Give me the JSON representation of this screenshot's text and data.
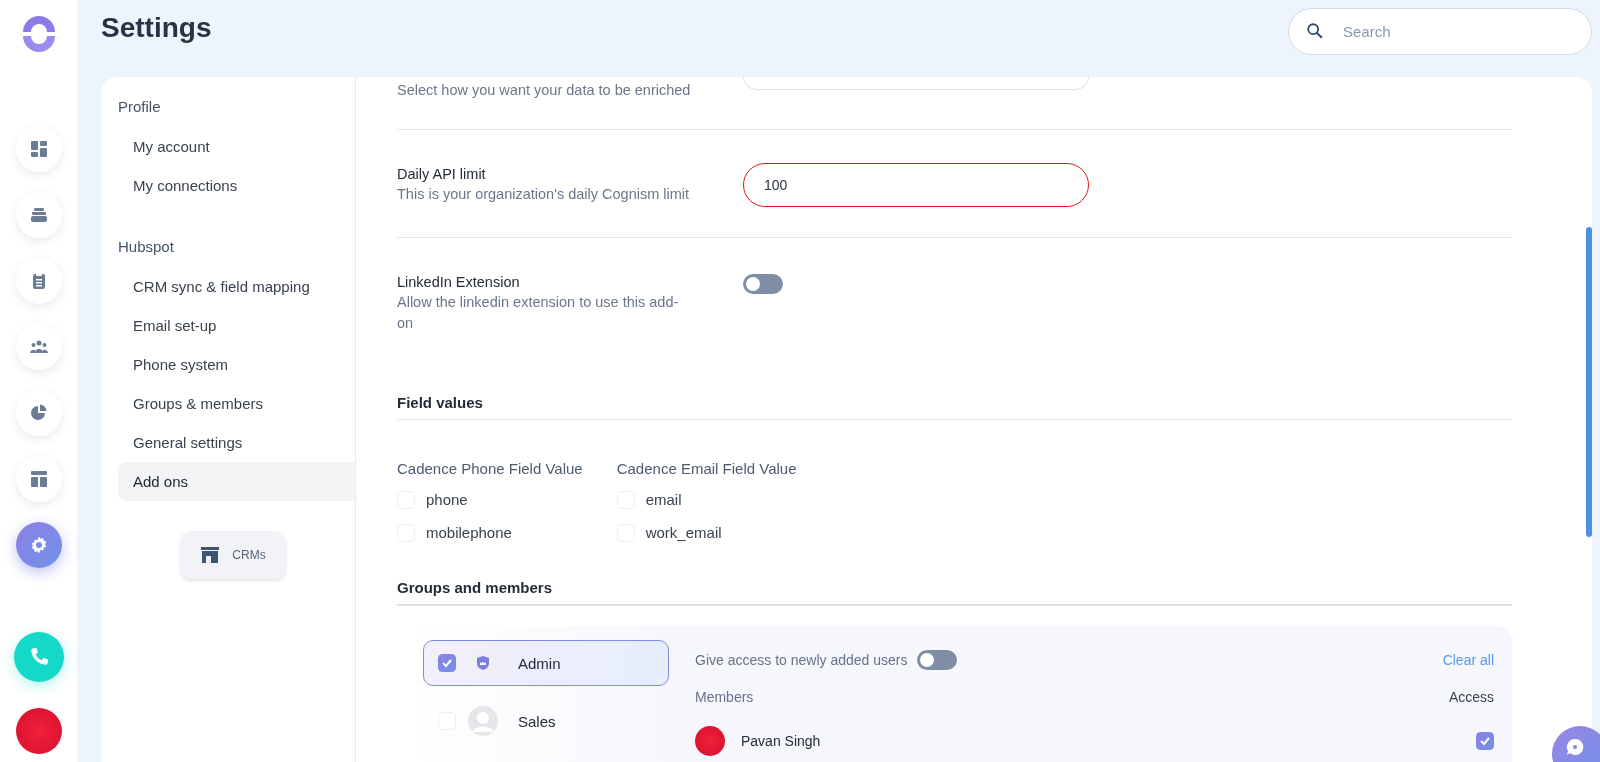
{
  "app": {
    "title": "Settings"
  },
  "search": {
    "placeholder": "Search"
  },
  "rail": [
    {
      "kind": "dashboard",
      "selected": false
    },
    {
      "kind": "inbox",
      "selected": false
    },
    {
      "kind": "clipboard",
      "selected": false
    },
    {
      "kind": "people",
      "selected": false
    },
    {
      "kind": "pie",
      "selected": false
    },
    {
      "kind": "layout",
      "selected": false
    },
    {
      "kind": "settings",
      "selected": true
    }
  ],
  "nav": {
    "sections": [
      {
        "title": "Profile",
        "items": [
          {
            "label": "My account",
            "selected": false
          },
          {
            "label": "My connections",
            "selected": false
          }
        ]
      },
      {
        "title": "Hubspot",
        "items": [
          {
            "label": "CRM sync & field mapping",
            "selected": false
          },
          {
            "label": "Email set-up",
            "selected": false
          },
          {
            "label": "Phone system",
            "selected": false
          },
          {
            "label": "Groups & members",
            "selected": false
          },
          {
            "label": "General settings",
            "selected": false
          },
          {
            "label": "Add ons",
            "selected": true
          }
        ]
      }
    ],
    "crm_button": "CRMs"
  },
  "settings": [
    {
      "kind": "select",
      "description": "Select how you want your data to be enriched"
    },
    {
      "kind": "input",
      "label": "Daily API limit",
      "description": "This is your organization's daily Cognism limit",
      "value": "100",
      "error": true
    },
    {
      "kind": "toggle",
      "label": "LinkedIn Extension",
      "description": "Allow the linkedin extension to use this add-on",
      "on": false
    }
  ],
  "field_values": {
    "title": "Field values",
    "columns": [
      {
        "title": "Cadence Phone Field Value",
        "options": [
          {
            "label": "phone",
            "checked": false
          },
          {
            "label": "mobilephone",
            "checked": false
          }
        ]
      },
      {
        "title": "Cadence Email Field Value",
        "options": [
          {
            "label": "email",
            "checked": false
          },
          {
            "label": "work_email",
            "checked": false
          }
        ]
      }
    ]
  },
  "groups": {
    "title": "Groups and members",
    "items": [
      {
        "name": "Admin",
        "kind": "shield",
        "selected": true,
        "checked": true
      },
      {
        "name": "Sales",
        "kind": "person",
        "selected": false,
        "checked": false
      }
    ],
    "auto_access_label": "Give access to newly added users",
    "auto_access_on": false,
    "clear_all": "Clear all",
    "members_header": "Members",
    "access_header": "Access",
    "members": [
      {
        "name": "Pavan Singh",
        "access": true
      }
    ]
  }
}
